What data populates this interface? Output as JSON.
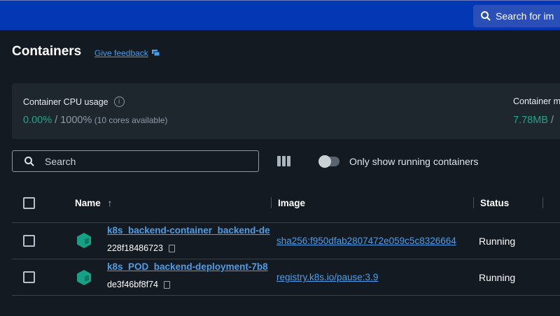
{
  "topbar": {
    "search_placeholder": "Search for im"
  },
  "page": {
    "title": "Containers",
    "feedback": "Give feedback"
  },
  "stats": {
    "cpu_label": "Container CPU usage",
    "cpu_used": "0.00%",
    "cpu_total": " / 1000%",
    "cpu_note": " (10 cores available)",
    "mem_label": "Container m",
    "mem_used": "7.78MB",
    "mem_sep": " /"
  },
  "toolbar": {
    "search_placeholder": "Search",
    "toggle_label": "Only show running containers",
    "toggle_on": false
  },
  "table": {
    "headers": {
      "name": "Name",
      "image": "Image",
      "status": "Status"
    },
    "rows": [
      {
        "name": "k8s_backend-container_backend-de",
        "id": "228f18486723",
        "image": "sha256:f950dfab2807472e059c5c8326664",
        "status": "Running"
      },
      {
        "name": "k8s_POD_backend-deployment-7b8",
        "id": "de3f46bf8f74",
        "image": "registry.k8s.io/pause:3.9",
        "status": "Running"
      }
    ]
  },
  "colors": {
    "topbar": "#0437b3",
    "accent": "#4b9ee8",
    "green": "#1ea48a",
    "container_icon": "#16a085"
  }
}
